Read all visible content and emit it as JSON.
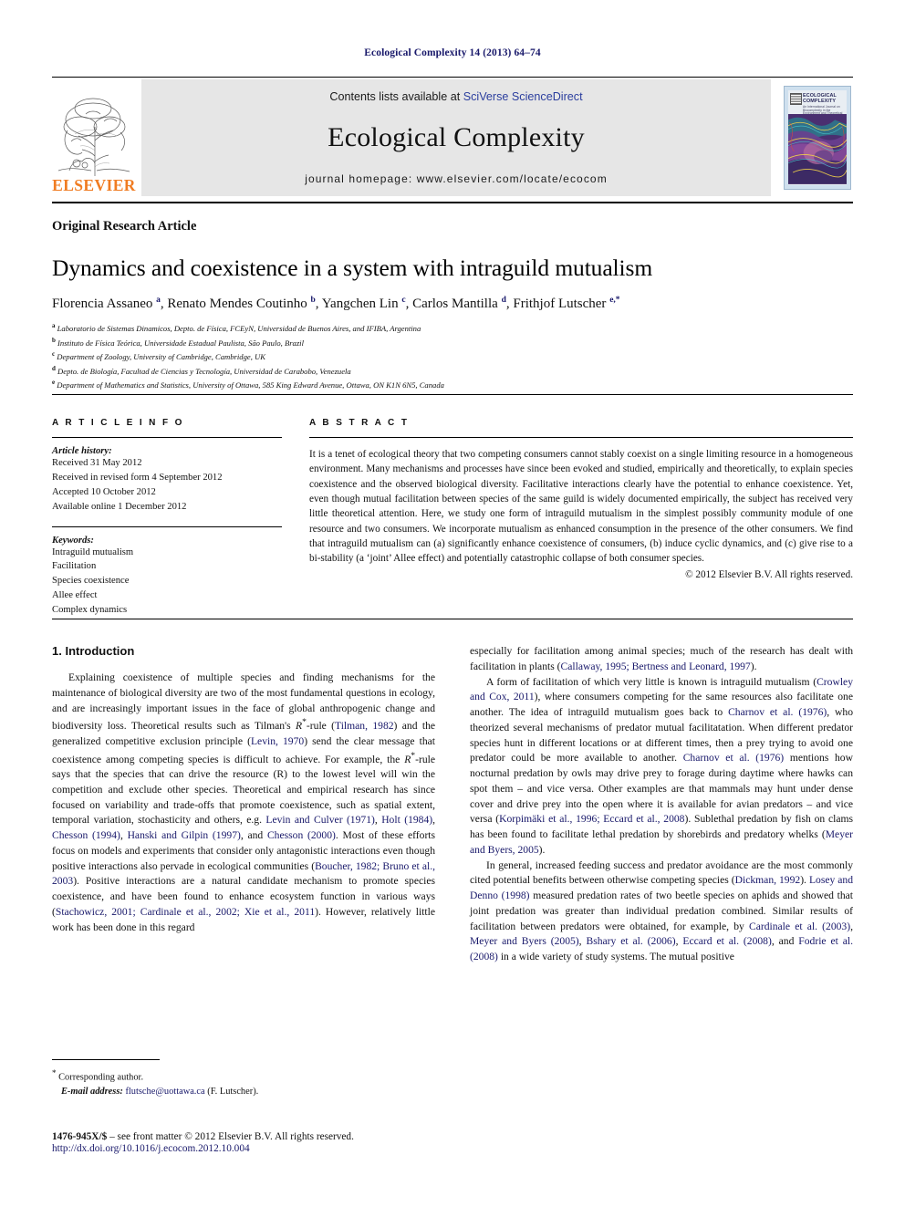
{
  "runninghead": "Ecological Complexity 14 (2013) 64–74",
  "masthead": {
    "publisher_word": "ELSEVIER",
    "contents_prefix": "Contents lists available at ",
    "contents_link": "SciVerse ScienceDirect",
    "journal_name": "Ecological Complexity",
    "homepage": "journal homepage: www.elsevier.com/locate/ecocom",
    "cover": {
      "line1": "ECOLOGICAL",
      "line2": "COMPLEXITY",
      "sub": "An International Journal on Biocomplexity in the Environment and Theoretical Ecology"
    }
  },
  "article": {
    "type": "Original Research Article",
    "title": "Dynamics and coexistence in a system with intraguild mutualism",
    "authors_html": "Florencia Assaneo <sup>a</sup>, Renato Mendes Coutinho <sup>b</sup>, Yangchen Lin <sup>c</sup>, Carlos Mantilla <sup>d</sup>, Frithjof Lutscher <sup>e,*</sup>",
    "affiliations": [
      {
        "mark": "a",
        "text": "Laboratorio de Sistemas Dinamicos, Depto. de Física, FCEyN, Universidad de Buenos Aires, and IFIBA, Argentina"
      },
      {
        "mark": "b",
        "text": "Instituto de Física Teórica, Universidade Estadual Paulista, São Paulo, Brazil"
      },
      {
        "mark": "c",
        "text": "Department of Zoology, University of Cambridge, Cambridge, UK"
      },
      {
        "mark": "d",
        "text": "Depto. de Biología, Facultad de Ciencias y Tecnología, Universidad de Carabobo, Venezuela"
      },
      {
        "mark": "e",
        "text": "Department of Mathematics and Statistics, University of Ottawa, 585 King Edward Avenue, Ottawa, ON K1N 6N5, Canada"
      }
    ]
  },
  "info": {
    "heading": "A R T I C L E  I N F O",
    "history_label": "Article history:",
    "history": [
      "Received 31 May 2012",
      "Received in revised form 4 September 2012",
      "Accepted 10 October 2012",
      "Available online 1 December 2012"
    ],
    "keywords_label": "Keywords:",
    "keywords": [
      "Intraguild mutualism",
      "Facilitation",
      "Species coexistence",
      "Allee effect",
      "Complex dynamics"
    ]
  },
  "abstract": {
    "heading": "A B S T R A C T",
    "text": "It is a tenet of ecological theory that two competing consumers cannot stably coexist on a single limiting resource in a homogeneous environment. Many mechanisms and processes have since been evoked and studied, empirically and theoretically, to explain species coexistence and the observed biological diversity. Facilitative interactions clearly have the potential to enhance coexistence. Yet, even though mutual facilitation between species of the same guild is widely documented empirically, the subject has received very little theoretical attention. Here, we study one form of intraguild mutualism in the simplest possibly community module of one resource and two consumers. We incorporate mutualism as enhanced consumption in the presence of the other consumers. We find that intraguild mutualism can (a) significantly enhance coexistence of consumers, (b) induce cyclic dynamics, and (c) give rise to a bi-stability (a ‘joint’ Allee effect) and potentially catastrophic collapse of both consumer species.",
    "copyright": "© 2012 Elsevier B.V. All rights reserved."
  },
  "body": {
    "section_title": "1. Introduction",
    "left_paragraphs": [
      "Explaining coexistence of multiple species and finding mechanisms for the maintenance of biological diversity are two of the most fundamental questions in ecology, and are increasingly important issues in the face of global anthropogenic change and biodiversity loss. Theoretical results such as Tilman's R*-rule (Tilman, 1982) and the generalized competitive exclusion principle (Levin, 1970) send the clear message that coexistence among competing species is difficult to achieve. For example, the R*-rule says that the species that can drive the resource (R) to the lowest level will win the competition and exclude other species. Theoretical and empirical research has since focused on variability and trade-offs that promote coexistence, such as spatial extent, temporal variation, stochasticity and others, e.g. Levin and Culver (1971), Holt (1984), Chesson (1994), Hanski and Gilpin (1997), and Chesson (2000). Most of these efforts focus on models and experiments that consider only antagonistic interactions even though positive interactions also pervade in ecological communities (Boucher, 1982; Bruno et al., 2003). Positive interactions are a natural candidate mechanism to promote species coexistence, and have been found to enhance ecosystem function in various ways (Stachowicz, 2001; Cardinale et al., 2002; Xie et al., 2011). However, relatively little work has been done in this regard"
    ],
    "right_paragraphs": [
      "especially for facilitation among animal species; much of the research has dealt with facilitation in plants (Callaway, 1995; Bertness and Leonard, 1997).",
      "A form of facilitation of which very little is known is intraguild mutualism (Crowley and Cox, 2011), where consumers competing for the same resources also facilitate one another. The idea of intraguild mutualism goes back to Charnov et al. (1976), who theorized several mechanisms of predator mutual facilitatation. When different predator species hunt in different locations or at different times, then a prey trying to avoid one predator could be more available to another. Charnov et al. (1976) mentions how nocturnal predation by owls may drive prey to forage during daytime where hawks can spot them – and vice versa. Other examples are that mammals may hunt under dense cover and drive prey into the open where it is available for avian predators – and vice versa (Korpimäki et al., 1996; Eccard et al., 2008). Sublethal predation by fish on clams has been found to facilitate lethal predation by shorebirds and predatory whelks (Meyer and Byers, 2005).",
      "In general, increased feeding success and predator avoidance are the most commonly cited potential benefits between otherwise competing species (Dickman, 1992). Losey and Denno (1998) measured predation rates of two beetle species on aphids and showed that joint predation was greater than individual predation combined. Similar results of facilitation between predators were obtained, for example, by Cardinale et al. (2003), Meyer and Byers (2005), Bshary et al. (2006), Eccard et al. (2008), and Fodrie et al. (2008) in a wide variety of study systems. The mutual positive"
    ]
  },
  "footnote": {
    "corresponding": "Corresponding author.",
    "email_label": "E-mail address:",
    "email": "flutsche@uottawa.ca",
    "email_suffix": "(F. Lutscher)."
  },
  "footer": {
    "issn_line_bold": "1476-945X/$ ",
    "issn_line_rest": "– see front matter © 2012 Elsevier B.V. All rights reserved.",
    "doi": "http://dx.doi.org/10.1016/j.ecocom.2012.10.004"
  },
  "colors": {
    "link": "#18186a",
    "elsevier_orange": "#f07c22",
    "band_gray": "#e6e6e6"
  }
}
